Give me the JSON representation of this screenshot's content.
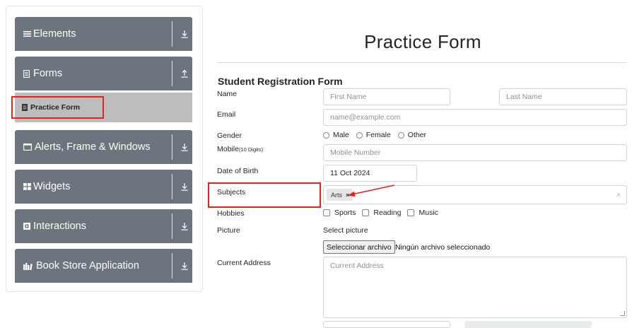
{
  "sidebar": {
    "groups": [
      {
        "label": "Elements",
        "icon": "menu-icon",
        "arrow": "download-arrow-icon"
      },
      {
        "label": "Forms",
        "icon": "document-icon",
        "arrow": "upload-arrow-icon"
      },
      {
        "label": "Alerts, Frame & Windows",
        "icon": "window-icon",
        "arrow": "download-arrow-icon"
      },
      {
        "label": "Widgets",
        "icon": "widgets-icon",
        "arrow": "download-arrow-icon"
      },
      {
        "label": "Interactions",
        "icon": "interactions-icon",
        "arrow": "download-arrow-icon"
      },
      {
        "label": "Book Store Application",
        "icon": "bookstore-icon",
        "arrow": "download-arrow-icon"
      }
    ],
    "active_item": {
      "label": "Practice Form",
      "icon": "form-icon"
    }
  },
  "form": {
    "page_title": "Practice Form",
    "heading": "Student Registration Form",
    "name": {
      "label": "Name",
      "first_placeholder": "First Name",
      "last_placeholder": "Last Name"
    },
    "email": {
      "label": "Email",
      "placeholder": "name@example.com"
    },
    "gender": {
      "label": "Gender",
      "options": [
        "Male",
        "Female",
        "Other"
      ]
    },
    "mobile": {
      "label": "Mobile",
      "label_small": "(10 Digits)",
      "placeholder": "Mobile Number"
    },
    "dob": {
      "label": "Date of Birth",
      "value": "11 Oct 2024"
    },
    "subjects": {
      "label": "Subjects",
      "chip": "Arts",
      "chip_remove": "×",
      "clear": "×"
    },
    "hobbies": {
      "label": "Hobbies",
      "options": [
        "Sports",
        "Reading",
        "Music"
      ]
    },
    "picture": {
      "label": "Picture",
      "select_text": "Select picture",
      "button": "Seleccionar archivo",
      "status": "Ningún archivo seleccionado"
    },
    "address": {
      "label": "Current Address",
      "placeholder": "Current Address"
    }
  },
  "colors": {
    "sidebar_group": "#6c757d",
    "active_item_bg": "#bdbdbd",
    "annotation_red": "#e1251b"
  }
}
